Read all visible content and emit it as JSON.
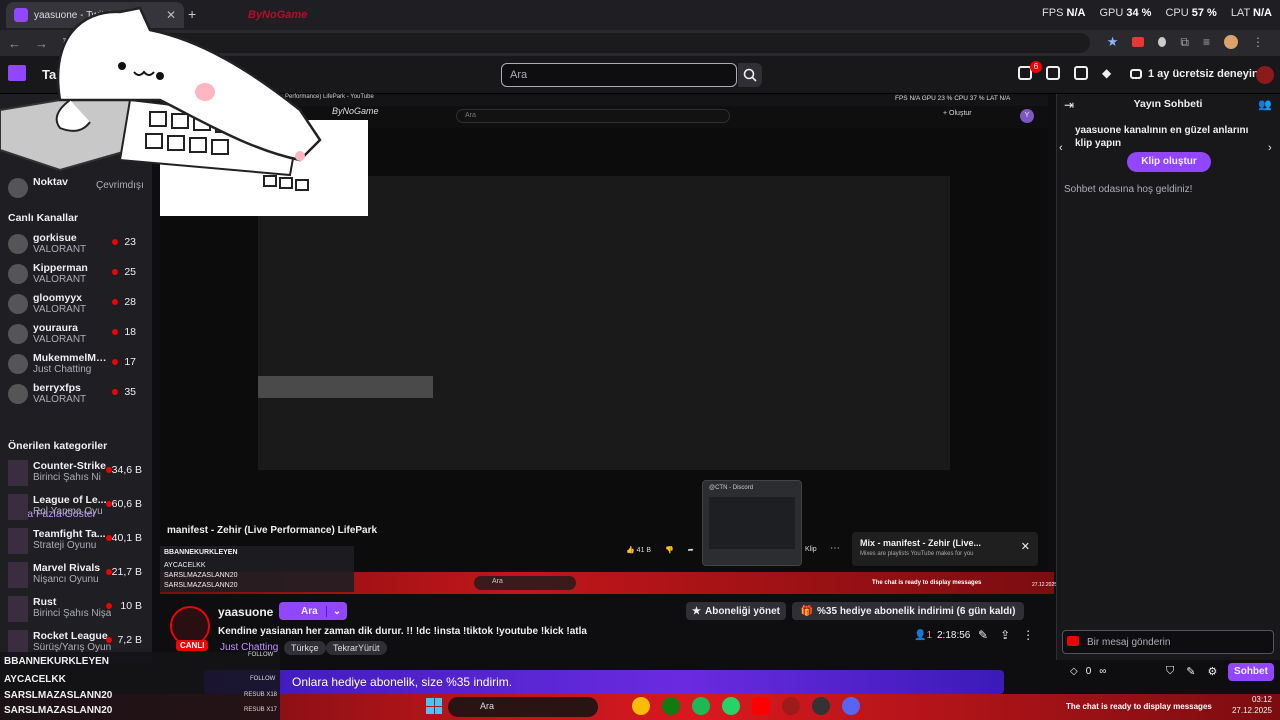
{
  "browser": {
    "tab_title": "yaasuone - Twitch",
    "fps": [
      {
        "label": "FPS",
        "value": "N/A"
      },
      {
        "label": "GPU",
        "value": "34 %"
      },
      {
        "label": "CPU",
        "value": "57 %"
      },
      {
        "label": "LAT",
        "value": "N/A"
      }
    ],
    "brand_text": "ByNoGame"
  },
  "topnav": {
    "follow_label": "Takip",
    "search_placeholder": "Ara",
    "notif_count": "6",
    "prime_label": "1 ay ücretsiz deneyin"
  },
  "sidebar": {
    "first_row": {
      "name": "Noktav",
      "status": "Çevrimdışı"
    },
    "live_header": "Canlı Kanallar",
    "live": [
      {
        "name": "gorkisue",
        "game": "VALORANT",
        "count": "23"
      },
      {
        "name": "Kipperman",
        "game": "VALORANT",
        "count": "25"
      },
      {
        "name": "gloomyyx",
        "game": "VALORANT",
        "count": "28"
      },
      {
        "name": "youraura",
        "game": "VALORANT",
        "count": "18"
      },
      {
        "name": "MukemmelMuge",
        "game": "Just Chatting",
        "count": "17"
      },
      {
        "name": "berryxfps",
        "game": "VALORANT",
        "count": "35"
      }
    ],
    "more_label": "Daha Fazla Göster",
    "cat_header": "Önerilen kategoriler",
    "categories": [
      {
        "name": "Counter-Strike",
        "genre": "Birinci Şahıs Ni",
        "count": "34,6 B"
      },
      {
        "name": "League of Le...",
        "genre": "Rol Yapma Oyu",
        "count": "60,6 B"
      },
      {
        "name": "Teamfight Ta...",
        "genre": "Strateji Oyunu",
        "count": "40,1 B"
      },
      {
        "name": "Marvel Rivals",
        "genre": "Nişancı Oyunu",
        "count": "21,7 B"
      },
      {
        "name": "Rust",
        "genre": "Birinci Şahıs Nişa",
        "count": "10 B"
      },
      {
        "name": "Rocket League",
        "genre": "Sürüş/Yarış Oyun",
        "count": "7,2 B"
      }
    ]
  },
  "video": {
    "inner_tab_title": "fest - Zehir (Live Performance) LifePark - YouTube",
    "inner_brand": "ByNoGame",
    "inner_search": "Ara",
    "inner_create": "Oluştur",
    "inner_fps": "FPS N/A  GPU 23 %  CPU 37 %  LAT N/A",
    "title": "manifest - Zehir (Live Performance) LifePark",
    "likes": "41 B",
    "clip_label": "Klip",
    "discord_title": "@CTN - Discord",
    "mix_title": "Mix - manifest - Zehir (Live...",
    "mix_sub": "Mixes are playlists YouTube makes for you",
    "strip_search": "Ara",
    "strip_chat_ready": "The chat is ready to display messages",
    "strip_date": "27.12.2025"
  },
  "channel": {
    "name": "yaasuone",
    "live_badge": "CANLI",
    "search_btn": "Ara",
    "title": "Kendine yasianan her zaman dik durur. !! !dc !insta !tiktok !youtube !kick !atla",
    "category": "Just Chatting",
    "tags": [
      "Türkçe",
      "TekrarYürüt"
    ],
    "manage_sub": "Aboneliği yönet",
    "gift_offer": "%35 hediye abonelik indirimi (6 gün kaldı)",
    "viewers": "1",
    "uptime": "2:18:56"
  },
  "chat": {
    "title": "Yayın Sohbeti",
    "clip_prompt": "yaasuone kanalının en güzel anlarını klip yapın",
    "clip_button": "Klip oluştur",
    "welcome": "Sohbet odasına hoş geldiniz!",
    "input_placeholder": "Bir mesaj gönderin",
    "points": "0",
    "send_label": "Sohbet"
  },
  "promo": {
    "text": "Onlara hediye abonelik, size %35 indirim."
  },
  "overlay_recent": {
    "header": "BBANNEKURKLEYEN",
    "follow": "FOLLOW",
    "rows": [
      {
        "name": "AYCACELKK",
        "tag": "FOLLOW"
      },
      {
        "name": "SARSLMAZASLANN20",
        "tag": "RESUB X18"
      },
      {
        "name": "SARSLMAZASLANN20",
        "tag": "RESUB X17"
      }
    ]
  },
  "taskbar": {
    "search": "Ara",
    "chat_ready": "The chat is ready to display messages",
    "time": "03:12",
    "date": "27.12.2025"
  },
  "colors": {
    "brand": "#9146ff",
    "live": "#eb0400",
    "taskbar": "#c3161a"
  }
}
